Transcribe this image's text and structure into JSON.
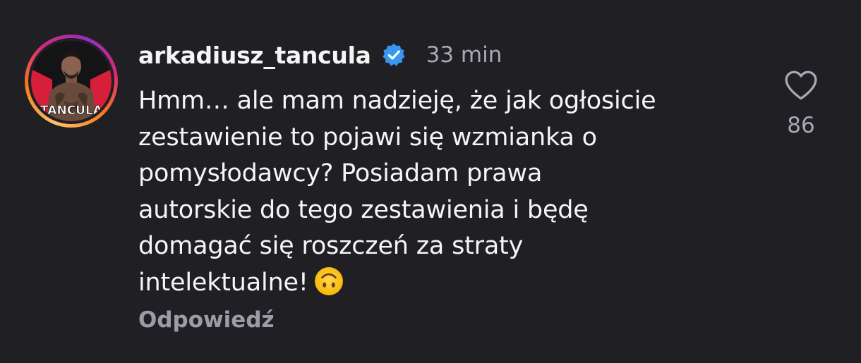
{
  "comment": {
    "avatar": {
      "icon": "profile-avatar",
      "label_text": "TANCULA"
    },
    "username": "arkadiusz_tancula",
    "verified_icon": "verified-badge-icon",
    "time": "33 min",
    "text_lines": [
      "Hmm… ale mam nadzieję, że jak ogłosicie",
      "zestawienie to pojawi się wzmianka o",
      "pomysłodawcy? Posiadam prawa",
      "autorskie do tego zestawienia i będę",
      "domagać się roszczeń za straty",
      "intelektualne!"
    ],
    "emoji": "upside-down-face",
    "reply_label": "Odpowiedź",
    "like": {
      "icon": "heart-icon",
      "count": "86"
    }
  },
  "colors": {
    "background": "#1f1f24",
    "text": "#f5f5f5",
    "muted": "#a8a8b3",
    "verified": "#3897f0"
  }
}
